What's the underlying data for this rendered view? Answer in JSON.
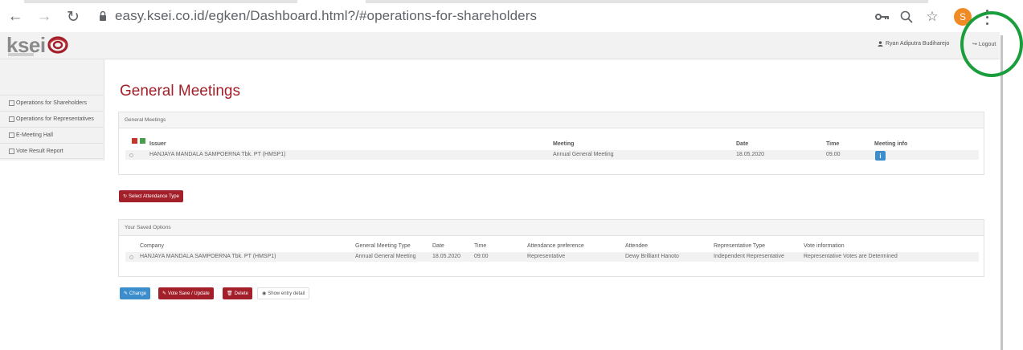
{
  "browser": {
    "url": "easy.ksei.co.id/egken/Dashboard.html?/#operations-for-shareholders",
    "profile_initial": "S",
    "back_icon": "arrow-left-icon",
    "forward_icon": "arrow-right-icon",
    "reload_icon": "reload-icon"
  },
  "header": {
    "logo_text": "ksei",
    "user_name": "Ryan Adiputra Budiharejo",
    "logout_label": "Logout"
  },
  "sidebar": {
    "items": [
      {
        "label": "Operations for Shareholders"
      },
      {
        "label": "Operations for Representatives"
      },
      {
        "label": "E-Meeting Hall"
      },
      {
        "label": "Vote Result Report"
      }
    ]
  },
  "main": {
    "title": "General Meetings",
    "meetings_panel": {
      "heading": "General Meetings",
      "columns": {
        "issuer": "Issuer",
        "meeting": "Meeting",
        "date": "Date",
        "time": "Time",
        "info": "Meeting info"
      },
      "row": {
        "issuer": "HANJAYA MANDALA SAMPOERNA Tbk. PT (HMSP1)",
        "meeting": "Annual General Meeting",
        "date": "18.05.2020",
        "time": "09.00",
        "info_label": "i"
      }
    },
    "select_attendance_label": "Select Attendance Type",
    "saved_panel": {
      "heading": "Your Saved Options",
      "columns": {
        "company": "Company",
        "meeting_type": "General Meeting Type",
        "date": "Date",
        "time": "Time",
        "attendance": "Attendance preference",
        "attendee": "Attendee",
        "rep_type": "Representative Type",
        "vote_info": "Vote information"
      },
      "row": {
        "company": "HANJAYA MANDALA SAMPOERNA Tbk. PT (HMSP1)",
        "meeting_type": "Annual General Meeting",
        "date": "18.05.2020",
        "time": "09:00",
        "attendance": "Representative",
        "attendee": "Dewy Brilliant Hanoto",
        "rep_type": "Independent Representative",
        "vote_info": "Representative Votes are Determined"
      }
    },
    "actions": {
      "change": "Change",
      "vote_save": "Vote Save / Update",
      "delete": "Delete",
      "show_detail": "Show entry detail"
    }
  },
  "colors": {
    "brand_red": "#a3202a",
    "action_blue": "#3c8dcc",
    "annotation_green": "#1a9e3c"
  }
}
